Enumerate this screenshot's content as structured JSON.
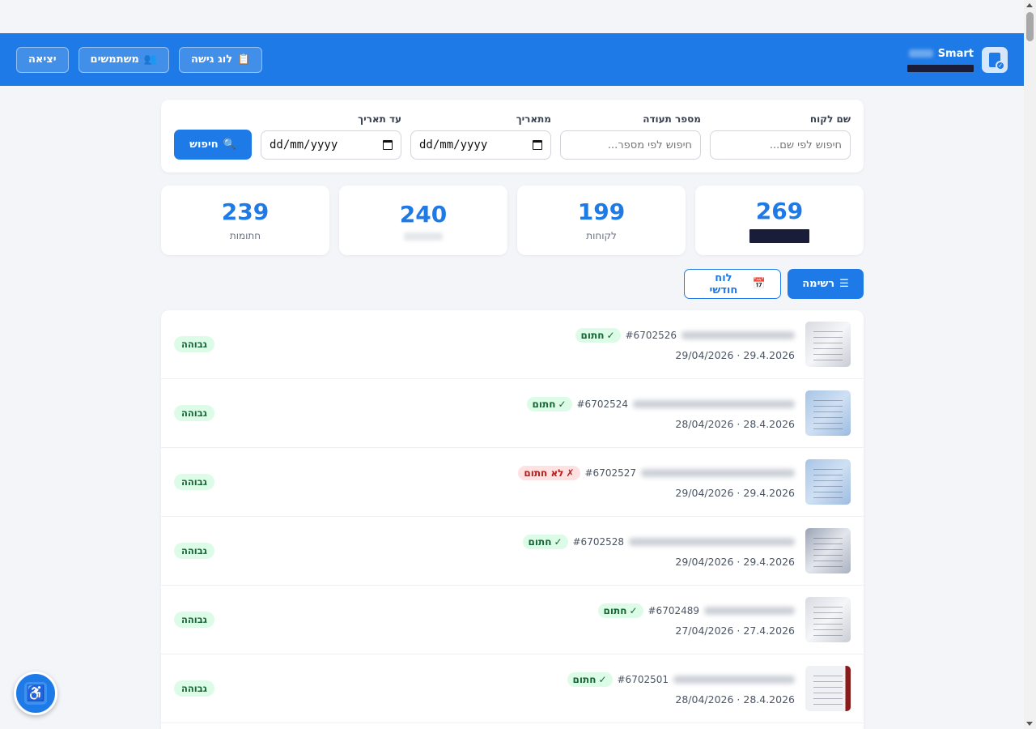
{
  "header": {
    "brand_name": "Smart",
    "buttons": {
      "logout": "יציאה",
      "users": "משתמשים",
      "users_icon": "👥",
      "access_log": "לוג גישה",
      "access_log_icon": "📋"
    }
  },
  "filters": {
    "customer_name": {
      "label": "שם לקוח",
      "placeholder": "חיפוש לפי שם..."
    },
    "doc_number": {
      "label": "מספר תעודה",
      "placeholder": "חיפוש לפי מספר..."
    },
    "from_date": {
      "label": "מתאריך",
      "value": "dd/mm/yyyy"
    },
    "to_date": {
      "label": "עד תאריך",
      "value": "dd/mm/yyyy"
    },
    "search_button": "חיפוש",
    "search_icon": "🔍"
  },
  "stats": [
    {
      "value": "269",
      "label": ""
    },
    {
      "value": "199",
      "label": "לקוחות"
    },
    {
      "value": "240",
      "label": ""
    },
    {
      "value": "239",
      "label": "חתומות"
    }
  ],
  "view_toggle": {
    "list": "רשימה",
    "list_icon": "☰",
    "calendar": "לוח חודשי",
    "calendar_icon": "📅"
  },
  "documents": [
    {
      "number": "#6702526",
      "status": "חתום",
      "status_icon": "✓",
      "date": "29.4.2026 · 29/04/2026",
      "priority": "גבוהה"
    },
    {
      "number": "#6702524",
      "status": "חתום",
      "status_icon": "✓",
      "date": "28.4.2026 · 28/04/2026",
      "priority": "גבוהה"
    },
    {
      "number": "#6702527",
      "status": "לא חתום",
      "status_icon": "✗",
      "date": "29.4.2026 · 29/04/2026",
      "priority": "גבוהה"
    },
    {
      "number": "#6702528",
      "status": "חתום",
      "status_icon": "✓",
      "date": "29.4.2026 · 29/04/2026",
      "priority": "גבוהה"
    },
    {
      "number": "#6702489",
      "status": "חתום",
      "status_icon": "✓",
      "date": "27.4.2026 · 27/04/2026",
      "priority": "גבוהה"
    },
    {
      "number": "#6702501",
      "status": "חתום",
      "status_icon": "✓",
      "date": "28.4.2026 · 28/04/2026",
      "priority": "גבוהה"
    }
  ],
  "accessibility_icon": "♿",
  "colors": {
    "primary": "#1e7ae6",
    "signed_bg": "#dcfce7",
    "unsigned_bg": "#fee2e2"
  }
}
